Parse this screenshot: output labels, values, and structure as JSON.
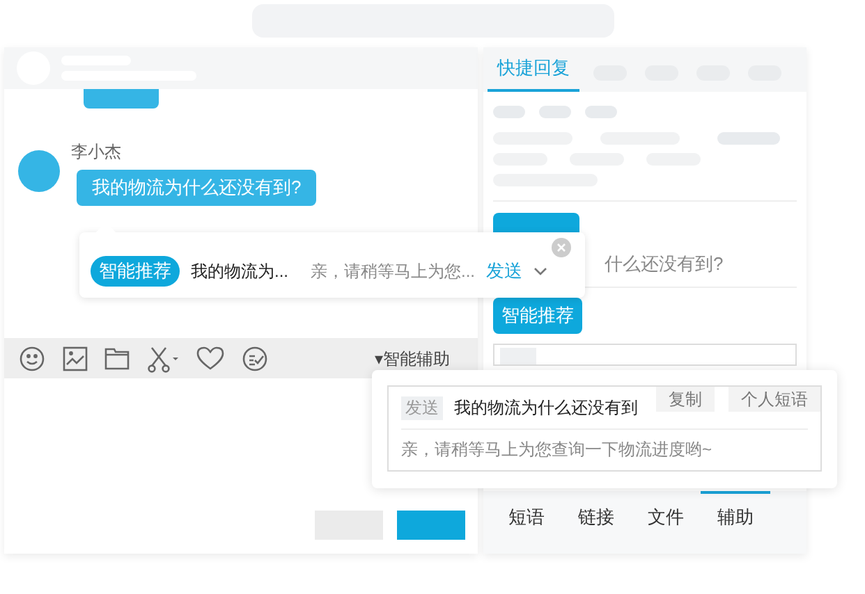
{
  "chat_panel": {
    "messages": [
      {
        "kind": "own"
      },
      {
        "kind": "customer",
        "sender": "李小杰",
        "text": "我的物流为什么还没有到?"
      }
    ],
    "assist_toggle": "▾智能辅助"
  },
  "suggestion_popup": {
    "badge": "智能推荐",
    "question": "我的物流为...",
    "answer": "亲，请稍等马上为您...",
    "send": "发送"
  },
  "side_panel": {
    "tabs": [
      {
        "label": "快捷回复",
        "selected": true
      }
    ],
    "question_fragment": "什么还没有到?",
    "recommend_button": "智能推荐",
    "footer_tabs": [
      {
        "label": "短语",
        "selected": false
      },
      {
        "label": "链接",
        "selected": false
      },
      {
        "label": "文件",
        "selected": false
      },
      {
        "label": "辅助",
        "selected": true
      }
    ]
  },
  "reply_popup": {
    "tag": "发送",
    "question": "我的物流为什么还没有到",
    "actions": [
      "复制",
      "个人短语"
    ],
    "answer": "亲，请稍等马上为您查询一下物流进度哟~"
  }
}
